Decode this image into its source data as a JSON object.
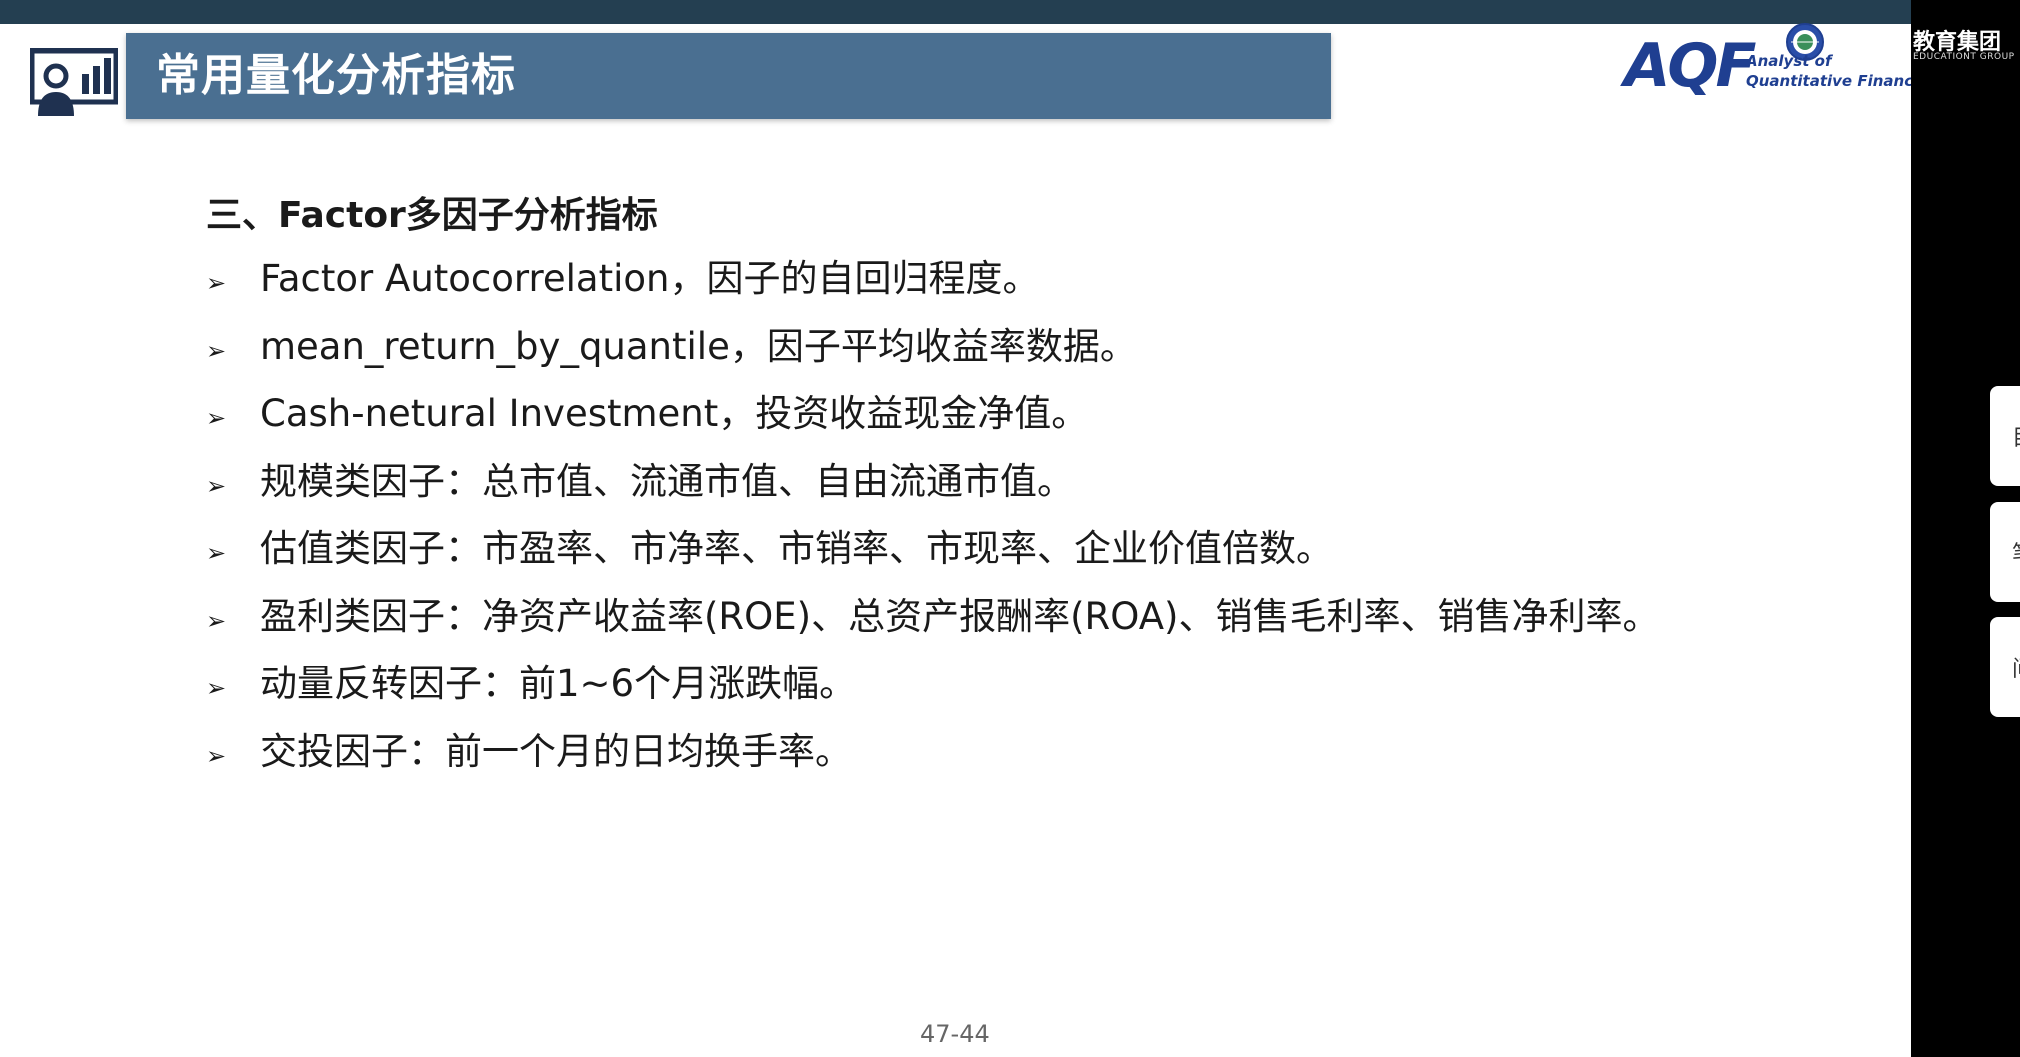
{
  "slide": {
    "title": "常用量化分析指标",
    "logo": {
      "letters": "AQF",
      "tagline_1": "Analyst of",
      "tagline_2": "Quantitative Finance"
    },
    "section_heading": "三、Factor多因子分析指标",
    "bullets": [
      "Factor Autocorrelation，因子的自回归程度。",
      "mean_return_by_quantile，因子平均收益率数据。",
      "Cash-netural Investment，投资收益现金净值。",
      "规模类因子：总市值、流通市值、自由流通市值。",
      "估值类因子：市盈率、市净率、市销率、市现率、企业价值倍数。",
      "盈利类因子：净资产收益率(ROE)、总资产报酬率(ROA)、销售毛利率、销售净利率。",
      "动量反转因子：前1~6个月涨跌幅。",
      "交投因子：前一个月的日均换手率。"
    ],
    "bullet_marker": "➢",
    "page_number": "47-44"
  },
  "brand_corner": {
    "name_cn": "教育集团",
    "name_en": "EDUCATIONT GROUP"
  },
  "side_tabs": [
    {
      "label": "目"
    },
    {
      "label": "笔"
    },
    {
      "label": "问"
    }
  ],
  "colors": {
    "title_bar": "#4a6f91",
    "top_strip": "#243f51",
    "logo_blue": "#1f3f91",
    "text": "#1a1a1a"
  }
}
